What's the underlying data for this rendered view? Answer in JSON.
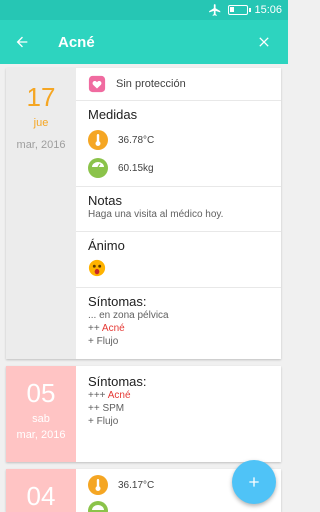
{
  "status_bar": {
    "time": "15:06",
    "icons": [
      "airplane-icon",
      "battery-icon"
    ]
  },
  "app_bar": {
    "title": "Acné",
    "back_icon": "back-arrow-icon",
    "close_icon": "close-icon"
  },
  "entries": [
    {
      "day": "17",
      "weekday": "jue",
      "month_year": "mar, 2016",
      "colors": {
        "date_bg": "#ececec",
        "day_text": "#f5a623"
      },
      "protection": {
        "icon": "heart-icon",
        "label": "Sin protección"
      },
      "measures": {
        "heading": "Medidas",
        "temperature": {
          "icon": "thermometer-icon",
          "value": "36.78°C"
        },
        "weight": {
          "icon": "scale-icon",
          "value": "60.15kg"
        }
      },
      "notes": {
        "heading": "Notas",
        "text": "Haga una visita al médico hoy."
      },
      "mood": {
        "heading": "Ánimo",
        "icon": "shocked-face-icon"
      },
      "symptoms": {
        "heading": "Síntomas:",
        "lines": [
          {
            "prefix": "... en zona pélvica",
            "value": ""
          },
          {
            "prefix": "++ ",
            "value": "Acné"
          },
          {
            "prefix": "+ Flujo",
            "value": ""
          }
        ]
      }
    },
    {
      "day": "05",
      "weekday": "sab",
      "month_year": "mar, 2016",
      "colors": {
        "date_bg": "#ffc4c4",
        "day_text": "#ffffff"
      },
      "symptoms": {
        "heading": "Síntomas:",
        "lines": [
          {
            "prefix": "+++ ",
            "value": "Acné"
          },
          {
            "prefix": "++ SPM",
            "value": ""
          },
          {
            "prefix": "+ Flujo",
            "value": ""
          }
        ]
      }
    },
    {
      "day": "04",
      "colors": {
        "date_bg": "#ffc4c4",
        "day_text": "#ffffff"
      },
      "measures": {
        "temperature": {
          "icon": "thermometer-icon",
          "value": "36.17°C"
        },
        "weight": {
          "icon": "scale-icon"
        }
      }
    }
  ],
  "fab": {
    "label": "+",
    "icon": "plus-icon"
  },
  "colors": {
    "primary": "#2dd4bf",
    "status_bar": "#26c6b4",
    "accent": "#4fc3f7",
    "highlight": "#e53935",
    "thermometer": "#f5a623",
    "scale": "#8bc34a",
    "heart": "#f06ba0"
  }
}
